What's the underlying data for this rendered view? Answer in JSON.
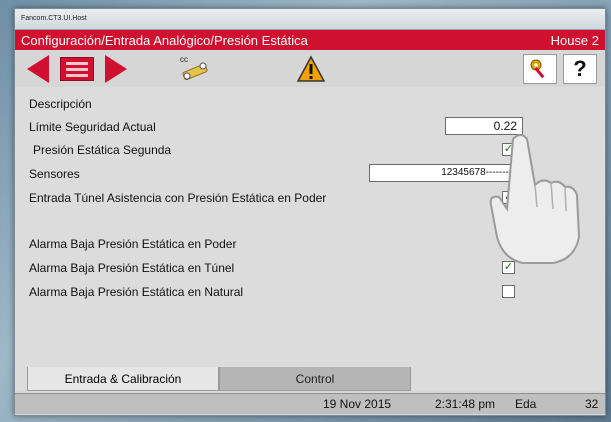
{
  "window": {
    "title": "Fancom.CT3.UI.Host"
  },
  "header": {
    "breadcrumb": "Configuración/Entrada Analógico/Presión Estática",
    "house": "House 2"
  },
  "toolbar": {
    "prev": "previous-arrow",
    "list": "list-icon",
    "next": "next-arrow",
    "cc_label": "cc",
    "warning": "warning-icon",
    "key": "key-icon",
    "help_label": "?"
  },
  "form": {
    "descripcion_label": "Descripción",
    "limite_label": "Límite Seguridad Actual",
    "limite_value": "0.22",
    "presion_segunda_label": "Presión Estática Segunda",
    "sensores_label": "Sensores",
    "sensores_value": "12345678-------",
    "entrada_tunel_label": "Entrada Túnel Asistencia con Presión Estática en Poder",
    "alarma_poder_label": "Alarma Baja Presión Estática en Poder",
    "alarma_tunel_label": "Alarma Baja Presión Estática en Túnel",
    "alarma_natural_label": "Alarma Baja Presión Estática en Natural",
    "checks": {
      "presion_segunda": true,
      "entrada_tunel": true,
      "alarma_tunel": true,
      "alarma_natural": false
    }
  },
  "tabs": [
    {
      "label": "Entrada & Calibración",
      "active": true
    },
    {
      "label": "Control",
      "active": false
    }
  ],
  "status": {
    "date": "19 Nov 2015",
    "time": "2:31:48 pm",
    "mode": "Eda",
    "number": "32"
  },
  "colors": {
    "accent": "#d0102f",
    "background": "#dcdcdc"
  }
}
